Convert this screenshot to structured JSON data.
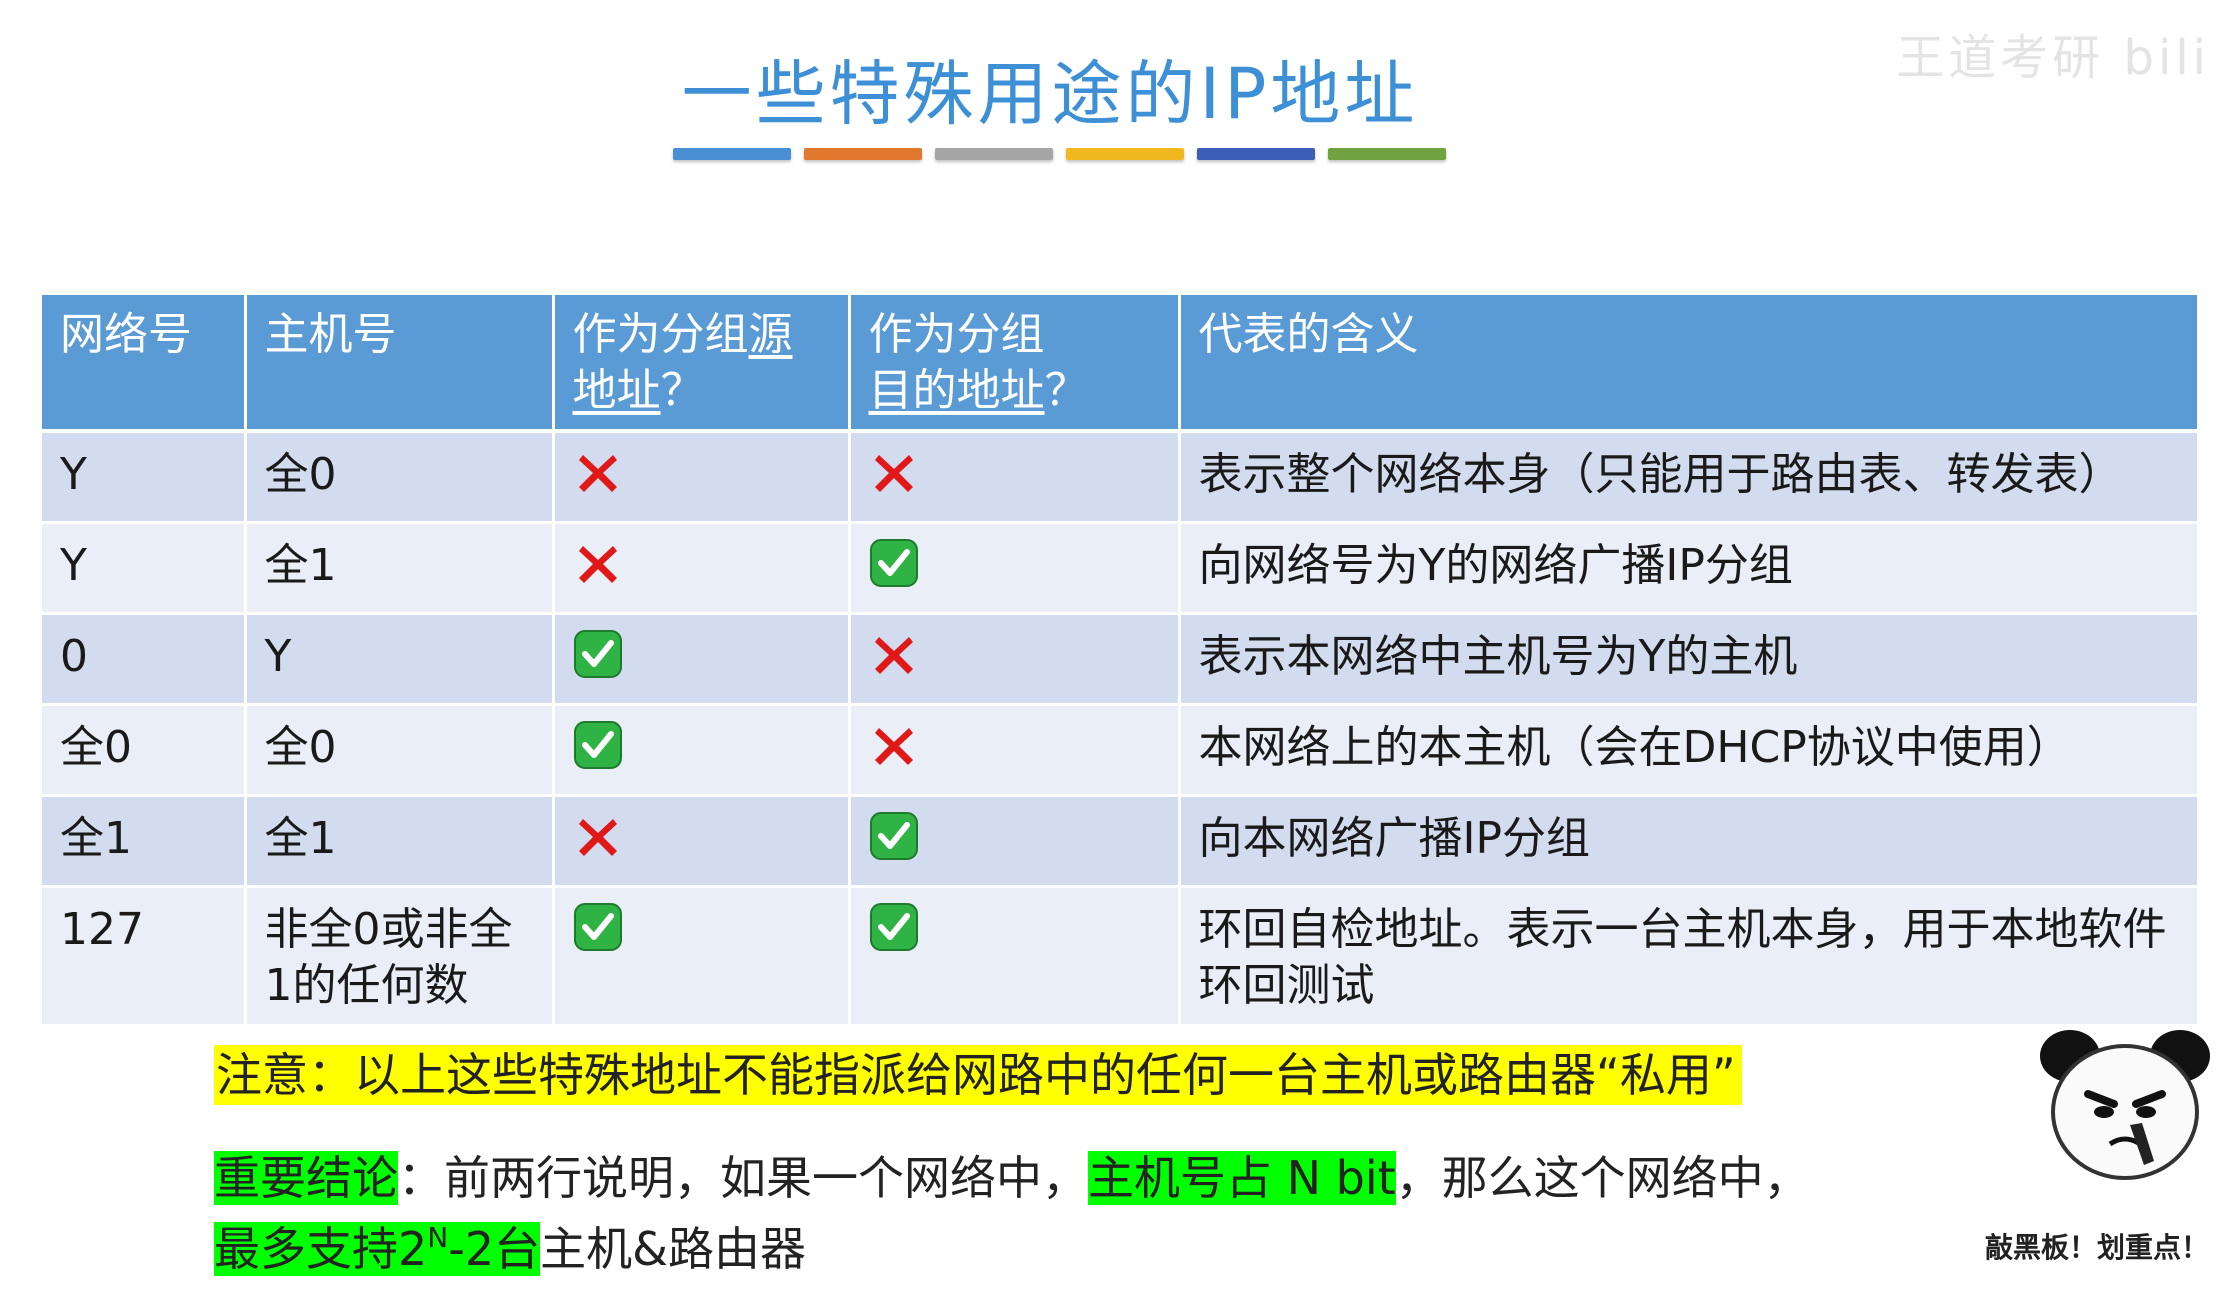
{
  "title": "一些特殊用途的IP地址",
  "title_bar_colors": [
    "#4a8fd3",
    "#e0782e",
    "#a6a6a6",
    "#f2b820",
    "#3b5fb8",
    "#70a33f"
  ],
  "watermark": "王道考研 bili",
  "table": {
    "headers": {
      "net": "网络号",
      "host": "主机号",
      "src_a": "作为分组",
      "src_b": "源",
      "src_c": "地址",
      "src_q": "？",
      "dst_a": "作为分组",
      "dst_b": "目的地址",
      "dst_q": "？",
      "meaning": "代表的含义"
    },
    "rows": [
      {
        "net": "Y",
        "host": "全0",
        "src": "cross",
        "dst": "cross",
        "meaning": "表示整个网络本身（只能用于路由表、转发表）"
      },
      {
        "net": "Y",
        "host": "全1",
        "src": "cross",
        "dst": "check",
        "meaning": "向网络号为Y的网络广播IP分组"
      },
      {
        "net": "0",
        "host": "Y",
        "src": "check",
        "dst": "cross",
        "meaning": "表示本网络中主机号为Y的主机"
      },
      {
        "net": "全0",
        "host": "全0",
        "src": "check",
        "dst": "cross",
        "meaning": "本网络上的本主机（会在DHCP协议中使用）"
      },
      {
        "net": "全1",
        "host": "全1",
        "src": "cross",
        "dst": "check",
        "meaning": "向本网络广播IP分组"
      },
      {
        "net": "127",
        "host": "非全0或非全1的任何数",
        "src": "check",
        "dst": "check",
        "meaning": "环回自检地址。表示一台主机本身，用于本地软件环回测试"
      }
    ]
  },
  "note": "注意：以上这些特殊地址不能指派给网路中的任何一台主机或路由器“私用”",
  "conclusion": {
    "label": "重要结论",
    "colon": "：",
    "part1": "前两行说明，如果一个网络中，",
    "hl_host": "主机号占 N bit",
    "part2": "，那么这个网络中，",
    "hl_max_a": "最多支持2",
    "hl_max_sup": "N",
    "hl_max_b": "-2台",
    "part3": "主机&路由器"
  },
  "meme_caption": "敲黑板！划重点！",
  "colors": {
    "header_bg": "#5b9bd5",
    "row_odd": "#d2dcee",
    "row_even": "#e9eef7",
    "highlight_yellow": "#ffff00",
    "highlight_green": "#00ff00",
    "cross": "#e01818",
    "check": "#2fb344"
  }
}
